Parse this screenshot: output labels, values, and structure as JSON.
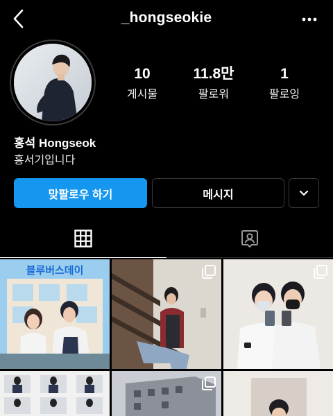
{
  "header": {
    "username": "_hongseokie",
    "back_icon": "chevron-left-icon",
    "more_icon": "more-horizontal-icon"
  },
  "profile": {
    "display_name": "홍석 Hongseok",
    "bio": "홍서기입니다"
  },
  "stats": {
    "posts": {
      "value": "10",
      "label": "게시물"
    },
    "followers": {
      "value": "11.8만",
      "label": "팔로워"
    },
    "following": {
      "value": "1",
      "label": "팔로잉"
    }
  },
  "actions": {
    "follow_back_label": "맞팔로우 하기",
    "message_label": "메시지",
    "more_icon": "chevron-down-icon"
  },
  "tabs": [
    {
      "name": "posts-grid",
      "icon": "grid-icon",
      "active": true
    },
    {
      "name": "tagged",
      "icon": "tagged-person-icon",
      "active": false
    }
  ],
  "posts": [
    {
      "caption_text": "블루버스데이",
      "multi": false
    },
    {
      "multi": true
    },
    {
      "multi": true
    },
    {
      "multi": false
    },
    {
      "multi": true
    },
    {
      "multi": false
    }
  ],
  "colors": {
    "background": "#000000",
    "primary_button": "#1597f0",
    "border": "#3a3a3a"
  }
}
